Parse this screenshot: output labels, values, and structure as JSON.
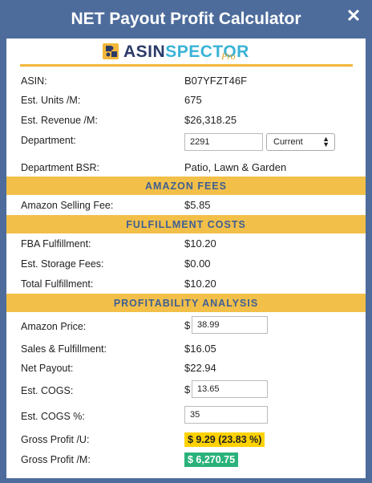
{
  "header": {
    "title": "NET Payout Profit Calculator"
  },
  "logo": {
    "text_a": "ASIN",
    "text_rest": "SPECTOR",
    "pro": "Pro"
  },
  "info": {
    "asin_label": "ASIN:",
    "asin_value": "B07YFZT46F",
    "units_label": "Est. Units /M:",
    "units_value": "675",
    "revenue_label": "Est. Revenue /M:",
    "revenue_value": "$26,318.25",
    "department_label": "Department:",
    "department_input": "2291",
    "department_select": "Current",
    "bsr_label": "Department BSR:",
    "bsr_value": "Patio, Lawn & Garden"
  },
  "amazon_fees": {
    "title": "AMAZON FEES",
    "selling_fee_label": "Amazon Selling Fee:",
    "selling_fee_value": "$5.85"
  },
  "fulfillment": {
    "title": "FULFILLMENT COSTS",
    "fba_label": "FBA Fulfillment:",
    "fba_value": "$10.20",
    "storage_label": "Est. Storage Fees:",
    "storage_value": "$0.00",
    "total_label": "Total Fulfillment:",
    "total_value": "$10.20"
  },
  "profitability": {
    "title": "PROFITABILITY ANALYSIS",
    "price_label": "Amazon Price:",
    "price_currency": "$",
    "price_value": "38.99",
    "sales_fulfillment_label": "Sales & Fulfillment:",
    "sales_fulfillment_value": "$16.05",
    "net_payout_label": "Net Payout:",
    "net_payout_value": "$22.94",
    "cogs_label": "Est. COGS:",
    "cogs_currency": "$",
    "cogs_value": "13.65",
    "cogs_pct_label": "Est. COGS %:",
    "cogs_pct_value": "35",
    "gross_u_label": "Gross Profit /U:",
    "gross_u_value": "$ 9.29 (23.83 %)",
    "gross_m_label": "Gross Profit /M:",
    "gross_m_value": "$ 6,270.75"
  },
  "colors": {
    "header_bg": "#4d6c9c",
    "section_bg": "#f2bf48",
    "section_text": "#3f5f93",
    "highlight_yellow": "#ffd200",
    "highlight_green": "#2ab27b"
  }
}
